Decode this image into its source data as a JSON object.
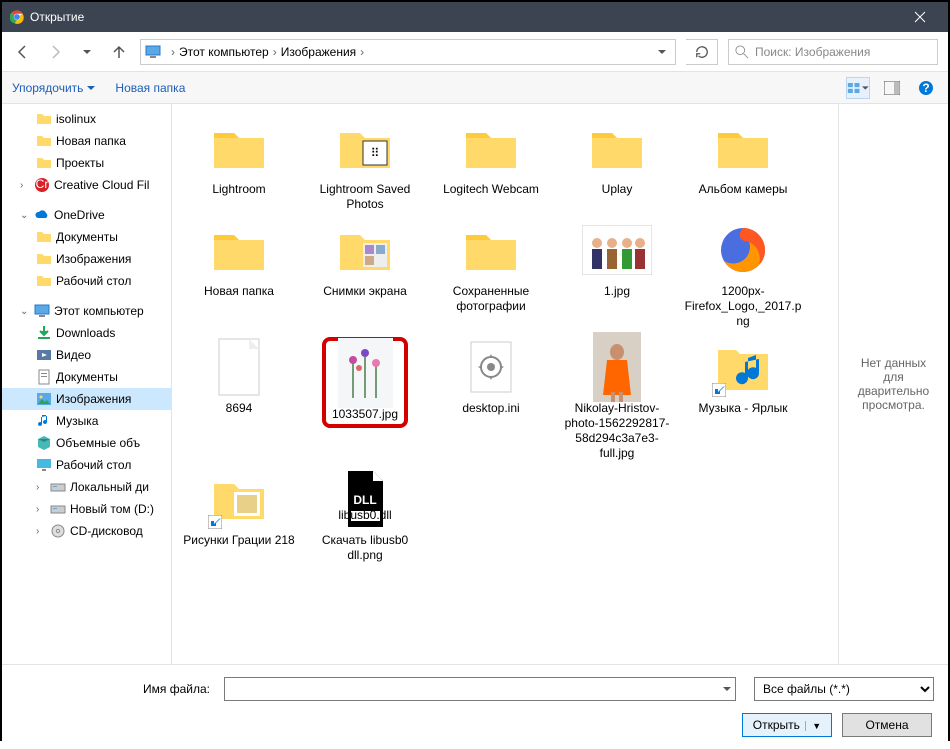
{
  "window": {
    "title": "Открытие"
  },
  "breadcrumb": {
    "root": "Этот компьютер",
    "current": "Изображения"
  },
  "search": {
    "placeholder": "Поиск: Изображения"
  },
  "toolbar": {
    "organize": "Упорядочить",
    "new_folder": "Новая папка"
  },
  "sidebar": {
    "items": [
      {
        "label": "isolinux",
        "lvl": 2,
        "icon": "folder"
      },
      {
        "label": "Новая папка",
        "lvl": 2,
        "icon": "folder"
      },
      {
        "label": "Проекты",
        "lvl": 2,
        "icon": "folder"
      },
      {
        "label": "Creative Cloud Fil",
        "lvl": 1,
        "icon": "cc",
        "expand": ">"
      },
      {
        "label": "OneDrive",
        "lvl": 1,
        "icon": "onedrive",
        "expand": "v"
      },
      {
        "label": "Документы",
        "lvl": 2,
        "icon": "folder"
      },
      {
        "label": "Изображения",
        "lvl": 2,
        "icon": "folder"
      },
      {
        "label": "Рабочий стол",
        "lvl": 2,
        "icon": "folder"
      },
      {
        "label": "Этот компьютер",
        "lvl": 1,
        "icon": "pc",
        "expand": "v"
      },
      {
        "label": "Downloads",
        "lvl": 2,
        "icon": "downloads"
      },
      {
        "label": "Видео",
        "lvl": 2,
        "icon": "video"
      },
      {
        "label": "Документы",
        "lvl": 2,
        "icon": "docs"
      },
      {
        "label": "Изображения",
        "lvl": 2,
        "icon": "pictures",
        "selected": true
      },
      {
        "label": "Музыка",
        "lvl": 2,
        "icon": "music"
      },
      {
        "label": "Объемные объ",
        "lvl": 2,
        "icon": "3d"
      },
      {
        "label": "Рабочий стол",
        "lvl": 2,
        "icon": "desktop"
      },
      {
        "label": "Локальный ди",
        "lvl": 2,
        "icon": "disk",
        "expand": ">"
      },
      {
        "label": "Новый том (D:)",
        "lvl": 2,
        "icon": "disk",
        "expand": ">"
      },
      {
        "label": "CD-дисковод",
        "lvl": 2,
        "icon": "cd",
        "expand": ">"
      }
    ]
  },
  "files": [
    {
      "name": "Lightroom",
      "type": "folder"
    },
    {
      "name": "Lightroom Saved Photos",
      "type": "folder-code"
    },
    {
      "name": "Logitech Webcam",
      "type": "folder"
    },
    {
      "name": "Uplay",
      "type": "folder"
    },
    {
      "name": "Альбом камеры",
      "type": "folder"
    },
    {
      "name": "Новая папка",
      "type": "folder"
    },
    {
      "name": "Снимки экрана",
      "type": "folder-preview"
    },
    {
      "name": "Сохраненные фотографии",
      "type": "folder"
    },
    {
      "name": "1.jpg",
      "type": "image-people"
    },
    {
      "name": "1200px-Firefox_Logo,_2017.png",
      "type": "firefox"
    },
    {
      "name": "8694",
      "type": "blank"
    },
    {
      "name": "1033507.jpg",
      "type": "flowers",
      "highlighted": true
    },
    {
      "name": "desktop.ini",
      "type": "ini"
    },
    {
      "name": "Nikolay-Hristov-photo-1562292817-58d294c3a7e3-full.jpg",
      "type": "orange"
    },
    {
      "name": "Музыка - Ярлык",
      "type": "music-shortcut"
    },
    {
      "name": "Рисунки Грации 218",
      "type": "folder-shortcut"
    },
    {
      "name": "Скачать libusb0 dll.png",
      "type": "dll"
    }
  ],
  "preview": {
    "text": "Нет данных для дварительно просмотра."
  },
  "bottom": {
    "filename_label": "Имя файла:",
    "filename_value": "",
    "filter": "Все файлы (*.*)",
    "open": "Открыть",
    "cancel": "Отмена"
  }
}
